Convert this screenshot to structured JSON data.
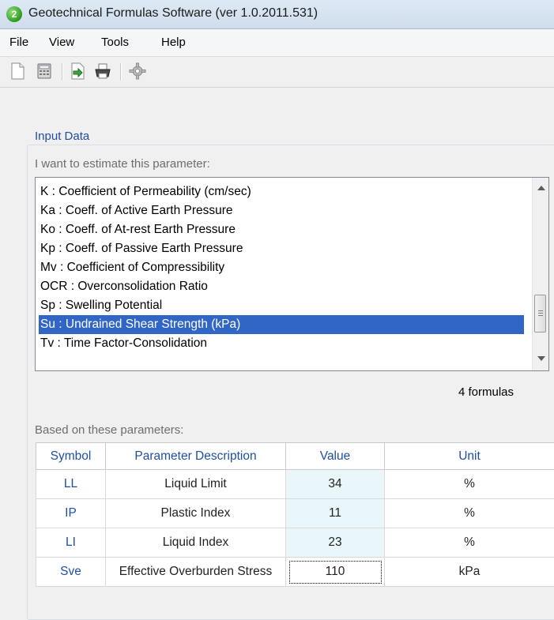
{
  "window": {
    "title": "Geotechnical Formulas Software (ver 1.0.2011.531)",
    "icon": "app-logo-icon"
  },
  "menu": [
    "File",
    "View",
    "Tools",
    "Help"
  ],
  "toolbar": [
    {
      "name": "new-document-icon"
    },
    {
      "name": "calculator-icon"
    },
    {
      "name": "export-icon"
    },
    {
      "name": "print-icon"
    },
    {
      "name": "settings-gear-icon"
    }
  ],
  "input": {
    "group_title": "Input Data",
    "prompt": "I want to estimate this parameter:",
    "parameters": [
      "K : Coefficient of Permeability (cm/sec)",
      "Ka : Coeff. of Active Earth Pressure",
      "Ko : Coeff. of At-rest Earth Pressure",
      "Kp : Coeff. of Passive Earth Pressure",
      "Mv : Coefficient of Compressibility",
      "OCR : Overconsolidation Ratio",
      "Sp : Swelling Potential",
      "Su : Undrained Shear Strength (kPa)",
      "Tv : Time Factor-Consolidation"
    ],
    "selected_index": 7,
    "formula_count": "4 formulas",
    "based_on": "Based on these parameters:"
  },
  "table": {
    "columns": [
      "Symbol",
      "Parameter Description",
      "Value",
      "Unit"
    ],
    "rows": [
      [
        "LL",
        "Liquid Limit",
        "34",
        "%"
      ],
      [
        "IP",
        "Plastic Index",
        "11",
        "%"
      ],
      [
        "LI",
        "Liquid Index",
        "23",
        "%"
      ],
      [
        "Sve",
        "Effective Overburden Stress",
        "110",
        "kPa"
      ]
    ]
  },
  "colors": {
    "accent": "#1f4fa3",
    "selection": "#3166c7",
    "value_cell": "#e9f7fb"
  }
}
